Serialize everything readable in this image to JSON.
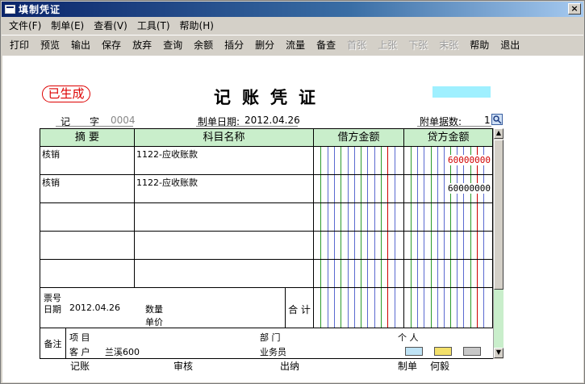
{
  "window": {
    "title": "填制凭证",
    "close_label": "×"
  },
  "menu": [
    "文件(F)",
    "制单(E)",
    "查看(V)",
    "工具(T)",
    "帮助(H)"
  ],
  "toolbar": [
    {
      "label": "打印",
      "enabled": true
    },
    {
      "label": "预览",
      "enabled": true
    },
    {
      "label": "输出",
      "enabled": true
    },
    {
      "label": "保存",
      "enabled": true
    },
    {
      "label": "放弃",
      "enabled": true
    },
    {
      "label": "查询",
      "enabled": true
    },
    {
      "label": "余额",
      "enabled": true
    },
    {
      "label": "插分",
      "enabled": true
    },
    {
      "label": "删分",
      "enabled": true
    },
    {
      "label": "流量",
      "enabled": true
    },
    {
      "label": "备查",
      "enabled": true
    },
    {
      "label": "首张",
      "enabled": false
    },
    {
      "label": "上张",
      "enabled": false
    },
    {
      "label": "下张",
      "enabled": false
    },
    {
      "label": "末张",
      "enabled": false
    },
    {
      "label": "帮助",
      "enabled": true
    },
    {
      "label": "退出",
      "enabled": true
    }
  ],
  "voucher": {
    "stamp": "已生成",
    "title": "记账凭证",
    "type_label": "记",
    "number_label": "字",
    "number": "0004",
    "date_label": "制单日期:",
    "date": "2012.04.26",
    "attach_label": "附单据数:",
    "attach_count": "1",
    "headers": {
      "summary": "摘 要",
      "account": "科目名称",
      "debit": "借方金额",
      "credit": "贷方金额"
    },
    "rows": [
      {
        "summary": "核销",
        "account": "1122-应收账款",
        "debit": "",
        "credit": "60000000",
        "credit_color": "#d00000"
      },
      {
        "summary": "核销",
        "account": "1122-应收账款",
        "debit": "",
        "credit": "60000000",
        "credit_color": "#000000"
      },
      {
        "summary": "",
        "account": "",
        "debit": "",
        "credit": ""
      },
      {
        "summary": "",
        "account": "",
        "debit": "",
        "credit": ""
      },
      {
        "summary": "",
        "account": "",
        "debit": "",
        "credit": ""
      }
    ],
    "bill_no_label": "票号",
    "bill_date_label": "日期",
    "bill_date": "2012.04.26",
    "qty_label": "数量",
    "price_label": "单价",
    "total_label": "合 计",
    "remark_label": "备注",
    "project_label": "项 目",
    "dept_label": "部 门",
    "person_label": "个 人",
    "customer_label": "客 户",
    "customer": "兰溪600",
    "salesman_label": "业务员"
  },
  "signatures": {
    "bookkeeper_label": "记账",
    "auditor_label": "审核",
    "cashier_label": "出纳",
    "maker_label": "制单",
    "maker": "何毅"
  }
}
